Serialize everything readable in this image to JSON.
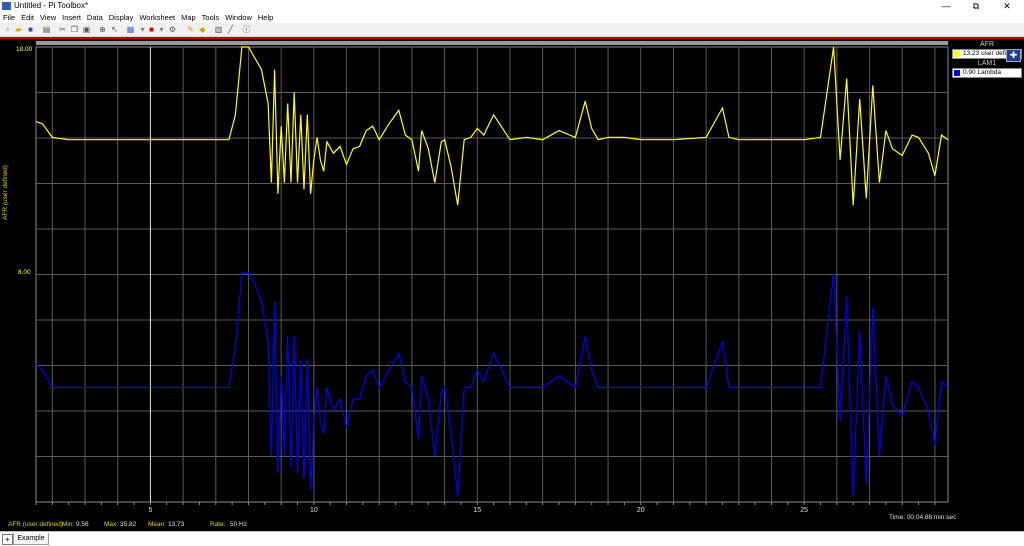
{
  "window": {
    "title": "Untitled - Pi Toolbox*",
    "minimize": "—",
    "maximize": "⧉",
    "close": "✕"
  },
  "menu": [
    "File",
    "Edit",
    "View",
    "Insert",
    "Data",
    "Display",
    "Worksheet",
    "Map",
    "Tools",
    "Window",
    "Help"
  ],
  "toolbar_icons": [
    "new-icon",
    "open-icon",
    "save-icon",
    "print-icon",
    "cut-icon",
    "copy-icon",
    "paste-icon",
    "zoom-icon",
    "cursor-icon",
    "color-icon",
    "grid-icon",
    "lock-icon",
    "pen-icon",
    "table-icon",
    "line-icon",
    "info-icon"
  ],
  "legend": {
    "entries": [
      {
        "title": "AFR",
        "value_text": "13.23 user defined",
        "color": "#ffff00"
      },
      {
        "title": "LAM1",
        "value_text": "0.90 Lambda",
        "color": "#0000ff"
      }
    ]
  },
  "plot": {
    "y_axis_label": "AFR (user defined)",
    "status": {
      "channel": "AFR (user defined)",
      "min_label": "Min:",
      "min": "9.56",
      "max_label": "Max:",
      "max": "35.82",
      "mean_label": "Mean:",
      "mean": "13.73",
      "rate_label": "Rate:",
      "rate": "50 Hz"
    },
    "time_readout": "Time: 00:04.88 min:sec"
  },
  "tabs": {
    "add": "+",
    "active": "Example"
  },
  "chart_data": {
    "type": "line",
    "x_range": [
      1.5,
      29.4
    ],
    "x_ticks": [
      5,
      10,
      15,
      20,
      25
    ],
    "grid": true,
    "cursor_x": 5.0,
    "series": [
      {
        "name": "AFR",
        "unit": "user defined",
        "color": "#ffff00",
        "y_range": [
          8.0,
          18.0
        ],
        "y_labels": [
          "18.00",
          "8.00"
        ],
        "x": [
          1.5,
          1.7,
          2.0,
          2.5,
          3,
          4,
          5,
          6,
          7,
          7.4,
          7.6,
          7.8,
          7.9,
          8.0,
          8.2,
          8.4,
          8.6,
          8.7,
          8.8,
          8.9,
          9.0,
          9.1,
          9.2,
          9.3,
          9.4,
          9.5,
          9.6,
          9.7,
          9.8,
          9.9,
          10.0,
          10.1,
          10.2,
          10.3,
          10.4,
          10.6,
          10.8,
          11.0,
          11.2,
          11.4,
          11.6,
          11.8,
          12.0,
          12.3,
          12.6,
          12.8,
          13.0,
          13.2,
          13.3,
          13.5,
          13.7,
          13.9,
          14.0,
          14.2,
          14.4,
          14.6,
          14.8,
          15.0,
          15.2,
          15.5,
          16.0,
          16.5,
          17.0,
          17.5,
          18.0,
          18.3,
          18.5,
          18.7,
          19.0,
          19.5,
          20.0,
          21.0,
          22.0,
          22.5,
          22.7,
          23.0,
          24.0,
          25.0,
          25.5,
          25.9,
          26.1,
          26.3,
          26.5,
          26.7,
          26.9,
          27.1,
          27.3,
          27.5,
          27.7,
          28.0,
          28.3,
          28.5,
          28.8,
          29.0,
          29.2,
          29.4
        ],
        "y": [
          14.7,
          14.6,
          14.0,
          13.9,
          13.9,
          13.9,
          13.9,
          13.9,
          13.9,
          13.9,
          15.0,
          18.0,
          18.0,
          18.0,
          17.5,
          17.0,
          15.5,
          12.0,
          17.0,
          11.5,
          14.5,
          12.0,
          15.5,
          12.0,
          16.0,
          12.0,
          15.0,
          11.7,
          15.0,
          11.5,
          13.0,
          14.0,
          13.0,
          12.5,
          13.8,
          13.3,
          13.6,
          12.8,
          13.5,
          13.6,
          14.3,
          14.5,
          13.9,
          14.6,
          15.2,
          14.1,
          13.9,
          12.5,
          14.3,
          13.5,
          12.0,
          13.8,
          13.9,
          12.7,
          11.0,
          13.9,
          14.0,
          14.4,
          14.1,
          15.0,
          13.9,
          14.0,
          13.9,
          14.3,
          14.0,
          15.6,
          14.4,
          13.9,
          14.0,
          14.0,
          13.9,
          13.9,
          14.0,
          15.3,
          14.0,
          13.9,
          13.9,
          13.9,
          14.0,
          18.0,
          13.0,
          16.6,
          11.0,
          15.7,
          11.3,
          16.3,
          12.0,
          14.3,
          13.5,
          13.2,
          14.1,
          14.0,
          13.3,
          12.3,
          14.1,
          13.9
        ]
      },
      {
        "name": "LAM1",
        "unit": "Lambda",
        "color": "#0000ff",
        "y_range": [
          0.7,
          1.1
        ],
        "x": [
          1.5,
          1.7,
          2.0,
          2.5,
          3,
          4,
          5,
          6,
          7,
          7.4,
          7.6,
          7.8,
          7.9,
          8.0,
          8.2,
          8.4,
          8.6,
          8.7,
          8.8,
          8.9,
          9.0,
          9.1,
          9.2,
          9.3,
          9.4,
          9.5,
          9.6,
          9.7,
          9.8,
          9.9,
          10.0,
          10.1,
          10.2,
          10.3,
          10.4,
          10.6,
          10.8,
          11.0,
          11.2,
          11.4,
          11.6,
          11.8,
          12.0,
          12.3,
          12.6,
          12.8,
          13.0,
          13.2,
          13.3,
          13.5,
          13.7,
          13.9,
          14.0,
          14.2,
          14.4,
          14.6,
          14.8,
          15.0,
          15.2,
          15.5,
          16.0,
          16.5,
          17.0,
          17.5,
          18.0,
          18.3,
          18.5,
          18.7,
          19.0,
          19.5,
          20.0,
          21.0,
          22.0,
          22.5,
          22.7,
          23.0,
          24.0,
          25.0,
          25.5,
          25.9,
          26.1,
          26.3,
          26.5,
          26.7,
          26.9,
          27.1,
          27.3,
          27.5,
          27.7,
          28.0,
          28.3,
          28.5,
          28.8,
          29.0,
          29.2,
          29.4
        ],
        "y": [
          0.94,
          0.93,
          0.9,
          0.9,
          0.9,
          0.9,
          0.9,
          0.9,
          0.9,
          0.9,
          0.97,
          1.1,
          1.1,
          1.1,
          1.08,
          1.05,
          0.98,
          0.78,
          1.05,
          0.75,
          0.92,
          0.78,
          0.99,
          0.76,
          0.99,
          0.75,
          0.95,
          0.74,
          0.95,
          0.72,
          0.84,
          0.9,
          0.84,
          0.82,
          0.9,
          0.86,
          0.88,
          0.83,
          0.88,
          0.88,
          0.92,
          0.93,
          0.9,
          0.93,
          0.96,
          0.91,
          0.9,
          0.81,
          0.92,
          0.88,
          0.78,
          0.89,
          0.9,
          0.82,
          0.71,
          0.9,
          0.9,
          0.93,
          0.91,
          0.96,
          0.9,
          0.9,
          0.9,
          0.92,
          0.9,
          0.99,
          0.93,
          0.9,
          0.9,
          0.9,
          0.9,
          0.9,
          0.9,
          0.98,
          0.9,
          0.9,
          0.9,
          0.9,
          0.9,
          1.1,
          0.84,
          1.06,
          0.71,
          1.0,
          0.73,
          1.04,
          0.78,
          0.92,
          0.87,
          0.85,
          0.91,
          0.9,
          0.86,
          0.8,
          0.91,
          0.9
        ]
      }
    ]
  }
}
